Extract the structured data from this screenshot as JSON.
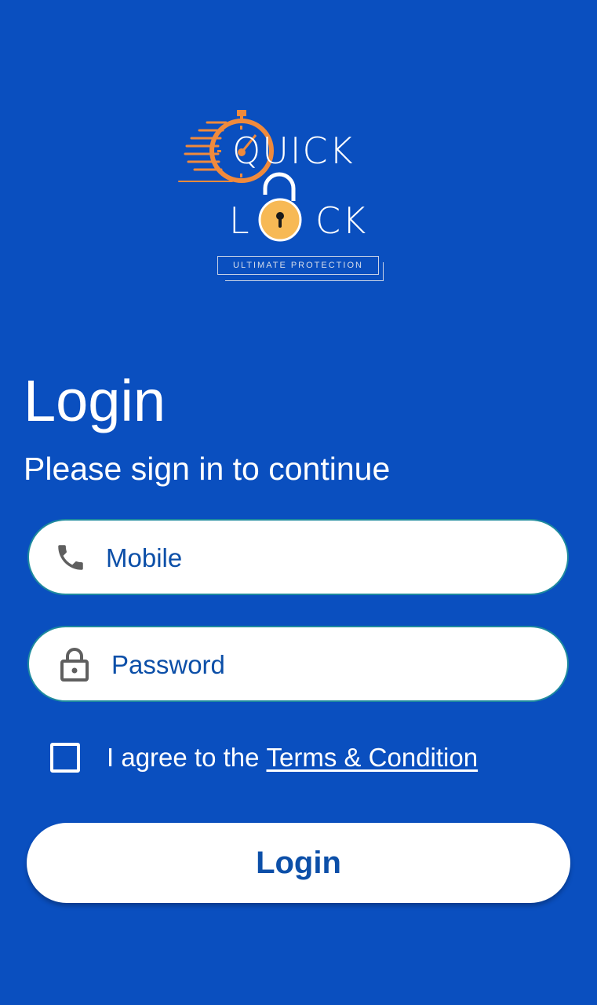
{
  "logo": {
    "word_top": "QUICK",
    "word_bottom_left": "L",
    "word_bottom_right": "CK",
    "tagline": "ULTIMATE PROTECTION",
    "accent_color": "#f08a3c",
    "lock_color": "#f7b955"
  },
  "header": {
    "title": "Login",
    "subtitle": "Please sign in to continue"
  },
  "form": {
    "mobile": {
      "icon": "phone-icon",
      "placeholder": "Mobile",
      "value": ""
    },
    "password": {
      "icon": "padlock-icon",
      "placeholder": "Password",
      "value": ""
    },
    "agree": {
      "checked": false,
      "text": "I agree to the",
      "link_text": "Terms & Condition"
    },
    "submit_label": "Login"
  },
  "colors": {
    "background": "#0a4fbf",
    "primary_text": "#0c4fa8",
    "field_border": "#1e8a9e"
  }
}
